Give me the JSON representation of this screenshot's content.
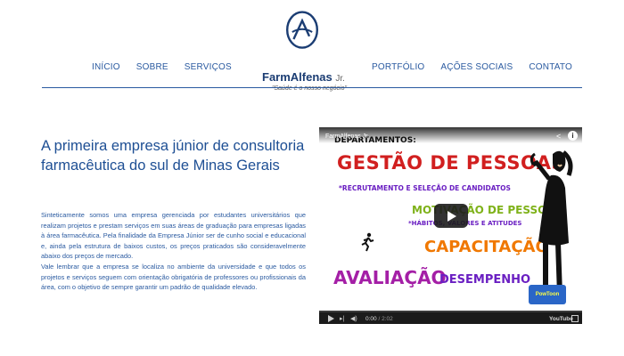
{
  "nav": {
    "left": [
      {
        "label": "INÍCIO"
      },
      {
        "label": "SOBRE"
      },
      {
        "label": "SERVIÇOS"
      }
    ],
    "right": [
      {
        "label": "PORTFÓLIO"
      },
      {
        "label": "AÇÕES SOCIAIS"
      },
      {
        "label": "CONTATO"
      }
    ]
  },
  "logo": {
    "name": "FarmAlfenas",
    "suffix": "Jr.",
    "tagline": "\"Saúde é o nosso negócio\""
  },
  "main": {
    "headline": "A primeira empresa júnior de consultoria farmacêutica do sul de Minas Gerais",
    "paragraph1": "Sinteticamente somos uma empresa gerenciada por estudantes universitários que realizam projetos e prestam serviços em suas áreas de graduação para empresas ligadas à área farmacêutica. Pela finalidade da Empresa Júnior ser de cunho social e educacional e, ainda pela estrutura de baixos custos, os preços praticados são consideravelmente abaixo dos preços de mercado.",
    "paragraph2": "Vale lembrar que a empresa se localiza no ambiente da universidade e que todos os projetos e serviços seguem com orientação obrigatória de professores ou profissionais da área, com o objetivo de sempre garantir um padrão de qualidade elevado."
  },
  "video": {
    "title": "FarmAlfenas Jr.",
    "slide": {
      "line_dep": "DEPARTAMENTOS:",
      "line_gestao": "GESTÃO DE PESSOAS",
      "line_recr": "*RECRUTAMENTO E SELEÇÃO DE CANDIDATOS",
      "line_motiv": "MOTIVAÇÃO DE PESSOAS",
      "line_hab": "*HÁBITOS, VALORES E ATITUDES",
      "line_capac": "CAPACITAÇÃO",
      "line_aval": "AVALIAÇÃO",
      "line_desemp": "DESEMPENHO",
      "badge": "PowToon"
    },
    "time_current": "0:00",
    "time_total": "/ 2:02",
    "brand": "YouTube",
    "colors": {
      "red": "#d11f1f",
      "purple": "#6a1fc2",
      "green": "#7fb21a",
      "orange": "#f07800",
      "magenta": "#a41fa6"
    }
  }
}
